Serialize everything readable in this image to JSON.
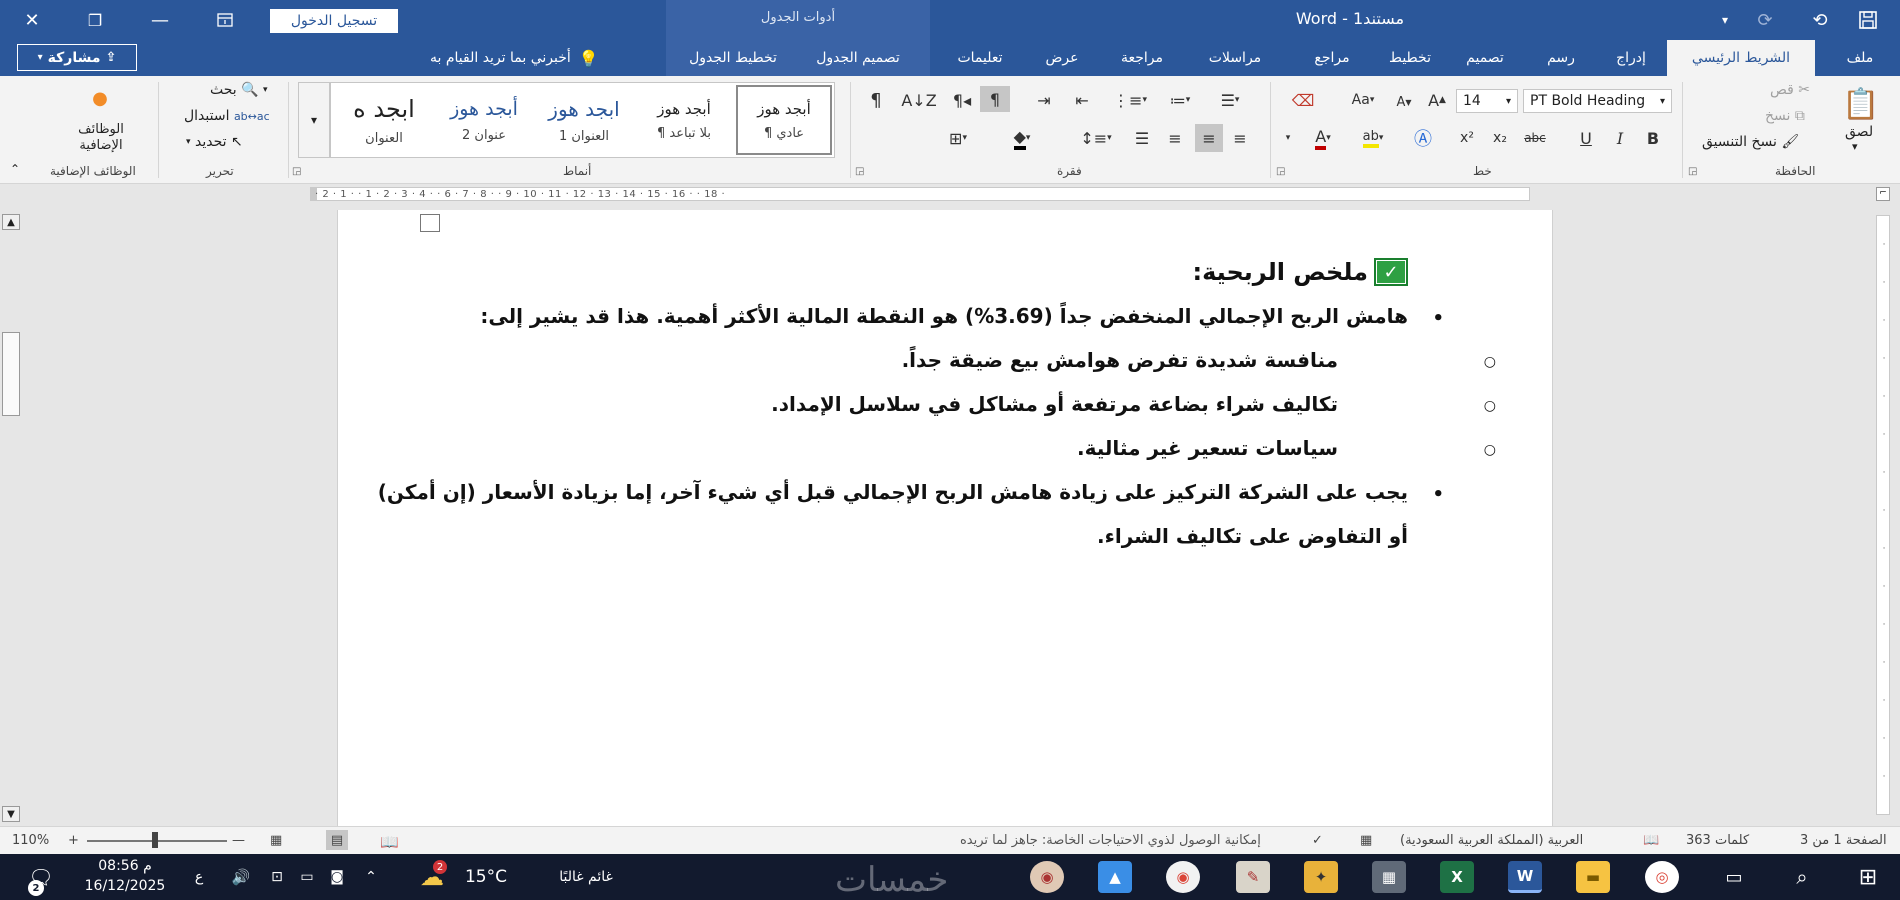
{
  "titlebar": {
    "doc_title": "Word  -  مستند1",
    "signin": "تسجيل الدخول",
    "table_tools": "أدوات الجدول",
    "icons": {
      "save": "save-icon",
      "redo": "redo-icon",
      "undo": "undo-icon",
      "customize": "dropdown-arrow-icon",
      "ribbon_display": "ribbon-display-icon",
      "minimize": "minimize-icon",
      "restore": "restore-icon",
      "close": "close-icon"
    },
    "accent": "#2b579a"
  },
  "tabs": [
    {
      "label": "ملف"
    },
    {
      "label": "الشريط الرئيسي",
      "active": true
    },
    {
      "label": "إدراج"
    },
    {
      "label": "رسم"
    },
    {
      "label": "تصميم"
    },
    {
      "label": "تخطيط"
    },
    {
      "label": "مراجع"
    },
    {
      "label": "مراسلات"
    },
    {
      "label": "مراجعة"
    },
    {
      "label": "عرض"
    },
    {
      "label": "تعليمات"
    },
    {
      "label": "تصميم الجدول"
    },
    {
      "label": "تخطيط الجدول"
    }
  ],
  "tell_me": "أخبرني بما تريد القيام به",
  "share": "مشاركة",
  "ribbon": {
    "clipboard": {
      "label": "الحافظة",
      "paste": "لصق",
      "cut": "قص",
      "copy": "نسخ",
      "format_painter": "نسخ التنسيق"
    },
    "font": {
      "label": "خط",
      "name": "PT Bold Heading",
      "size": "14",
      "bold": "B",
      "italic": "I",
      "underline": "U",
      "strike": "abc",
      "subscript": "x₂",
      "superscript": "x²",
      "grow": "A",
      "shrink": "A",
      "change_case": "Aa"
    },
    "paragraph": {
      "label": "فقرة",
      "pilcrow": "¶"
    },
    "styles": {
      "label": "أنماط",
      "items": [
        {
          "sample": "أبجد هوز",
          "name": "¶ عادي"
        },
        {
          "sample": "أبجد هوز",
          "name": "¶ بلا تباعد"
        },
        {
          "sample": "ابجد هوز",
          "name": "العنوان 1"
        },
        {
          "sample": "أبجد هوز",
          "name": "عنوان 2"
        },
        {
          "sample": "ابجد ه",
          "name": "العنوان"
        }
      ]
    },
    "editing": {
      "label": "تحرير",
      "find": "بحث",
      "replace": "استبدال",
      "select": "تحديد"
    },
    "addins": {
      "label": "الوظائف الإضافية",
      "button": "الوظائف الإضافية"
    }
  },
  "ruler": {
    "top": "·  2  ·  1  ·       ·  1  ·  2  ·  3  ·  4  ·     ·  6  ·  7  ·  8  ·           ·  9  ·  10  ·  11  ·  12  ·  13  ·  14  ·  15  ·  16  ·         ·  18  ·"
  },
  "document": {
    "heading": "ملخص الربحية:",
    "bullets": [
      {
        "text": "هامش الربح الإجمالي المنخفض جداً (3.69%) هو النقطة المالية الأكثر أهمية. هذا قد يشير إلى:",
        "sub": [
          "منافسة شديدة تفرض هوامش بيع ضيقة جداً.",
          "تكاليف شراء بضاعة مرتفعة أو مشاكل في سلاسل الإمداد.",
          "سياسات تسعير غير مثالية."
        ]
      },
      {
        "line1": "يجب على الشركة التركيز على زيادة هامش الربح الإجمالي قبل أي شيء آخر، إما بزيادة الأسعار (إن أمكن)",
        "line2": "أو التفاوض على تكاليف الشراء."
      }
    ]
  },
  "statusbar": {
    "page": "الصفحة 1 من 3",
    "words": "363 كلمات",
    "language": "العربية (المملكة العربية السعودية)",
    "accessibility": "إمكانية الوصول لذوي الاحتياجات الخاصة: جاهز لما تريده",
    "zoom": "110%",
    "zoom_percent": 110
  },
  "taskbar": {
    "time": "08:56 م",
    "date": "16/12/2025",
    "lang": "ع",
    "notif_count": "2",
    "weather_temp": "15°C",
    "weather_desc": "غائم غالبًا",
    "weather_badge": "2",
    "watermark": "خمسات"
  }
}
